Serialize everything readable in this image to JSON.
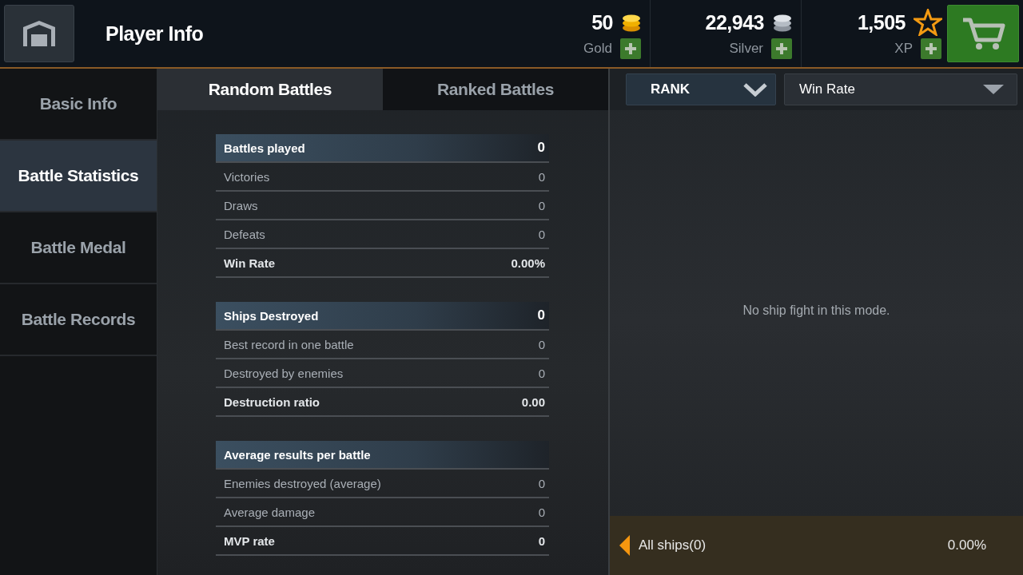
{
  "header": {
    "title": "Player Info",
    "currencies": [
      {
        "kind": "gold",
        "amount": "50",
        "label": "Gold"
      },
      {
        "kind": "silver",
        "amount": "22,943",
        "label": "Silver"
      },
      {
        "kind": "xp",
        "amount": "1,505",
        "label": "XP"
      }
    ]
  },
  "sidebar": {
    "items": [
      {
        "label": "Basic Info",
        "selected": false
      },
      {
        "label": "Battle Statistics",
        "selected": true
      },
      {
        "label": "Battle Medal",
        "selected": false
      },
      {
        "label": "Battle Records",
        "selected": false
      }
    ]
  },
  "tabs": [
    {
      "label": "Random Battles",
      "selected": true
    },
    {
      "label": "Ranked Battles",
      "selected": false
    }
  ],
  "stat_groups": [
    {
      "rows": [
        {
          "kind": "header",
          "label": "Battles played",
          "value": "0"
        },
        {
          "kind": "plain",
          "label": "Victories",
          "value": "0"
        },
        {
          "kind": "plain",
          "label": "Draws",
          "value": "0"
        },
        {
          "kind": "plain",
          "label": "Defeats",
          "value": "0"
        },
        {
          "kind": "total",
          "label": "Win Rate",
          "value": "0.00%"
        }
      ]
    },
    {
      "rows": [
        {
          "kind": "header",
          "label": "Ships Destroyed",
          "value": "0"
        },
        {
          "kind": "plain",
          "label": "Best record in one battle",
          "value": "0"
        },
        {
          "kind": "plain",
          "label": "Destroyed by enemies",
          "value": "0"
        },
        {
          "kind": "total",
          "label": "Destruction ratio",
          "value": "0.00"
        }
      ]
    },
    {
      "rows": [
        {
          "kind": "header",
          "label": "Average results per battle"
        },
        {
          "kind": "plain",
          "label": "Enemies destroyed (average)",
          "value": "0"
        },
        {
          "kind": "plain",
          "label": "Average damage",
          "value": "0"
        },
        {
          "kind": "total",
          "label": "MVP rate",
          "value": "0"
        }
      ]
    }
  ],
  "filters": {
    "sort": "RANK",
    "metric": "Win Rate"
  },
  "empty_message": "No ship fight in this mode.",
  "footer": {
    "label": "All ships(0)",
    "value": "0.00%"
  }
}
